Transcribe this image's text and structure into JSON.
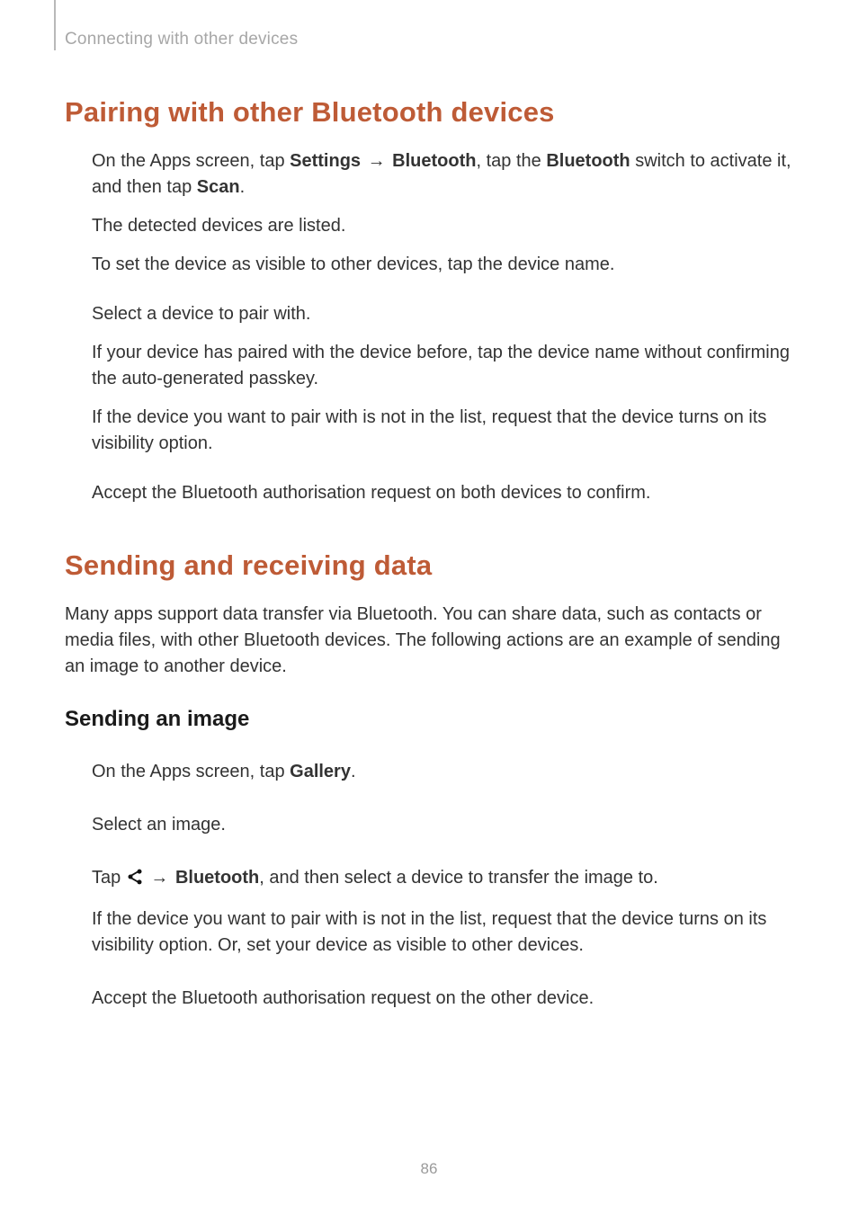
{
  "header": {
    "breadcrumb": "Connecting with other devices"
  },
  "section1": {
    "title": "Pairing with other Bluetooth devices",
    "step1": {
      "pre": "On the Apps screen, tap ",
      "b1": "Settings",
      "arrow": " → ",
      "b2": "Bluetooth",
      "mid": ", tap the ",
      "b3": "Bluetooth",
      "post": " switch to activate it, and then tap ",
      "b4": "Scan",
      "end": "."
    },
    "step1a": "The detected devices are listed.",
    "step1b": "To set the device as visible to other devices, tap the device name.",
    "step2": "Select a device to pair with.",
    "step2a": "If your device has paired with the device before, tap the device name without confirming the auto-generated passkey.",
    "step2b": "If the device you want to pair with is not in the list, request that the device turns on its visibility option.",
    "step3": "Accept the Bluetooth authorisation request on both devices to confirm."
  },
  "section2": {
    "title": "Sending and receiving data",
    "lead": "Many apps support data transfer via Bluetooth. You can share data, such as contacts or media files, with other Bluetooth devices. The following actions are an example of sending an image to another device.",
    "sub": "Sending an image",
    "step1": {
      "pre": "On the Apps screen, tap ",
      "b1": "Gallery",
      "end": "."
    },
    "step2": "Select an image.",
    "step3": {
      "pre": "Tap ",
      "arrow": " → ",
      "b1": "Bluetooth",
      "post": ", and then select a device to transfer the image to."
    },
    "step3a": "If the device you want to pair with is not in the list, request that the device turns on its visibility option. Or, set your device as visible to other devices.",
    "step4": "Accept the Bluetooth authorisation request on the other device."
  },
  "pagenum": "86",
  "icons": {
    "share": "share-icon"
  }
}
